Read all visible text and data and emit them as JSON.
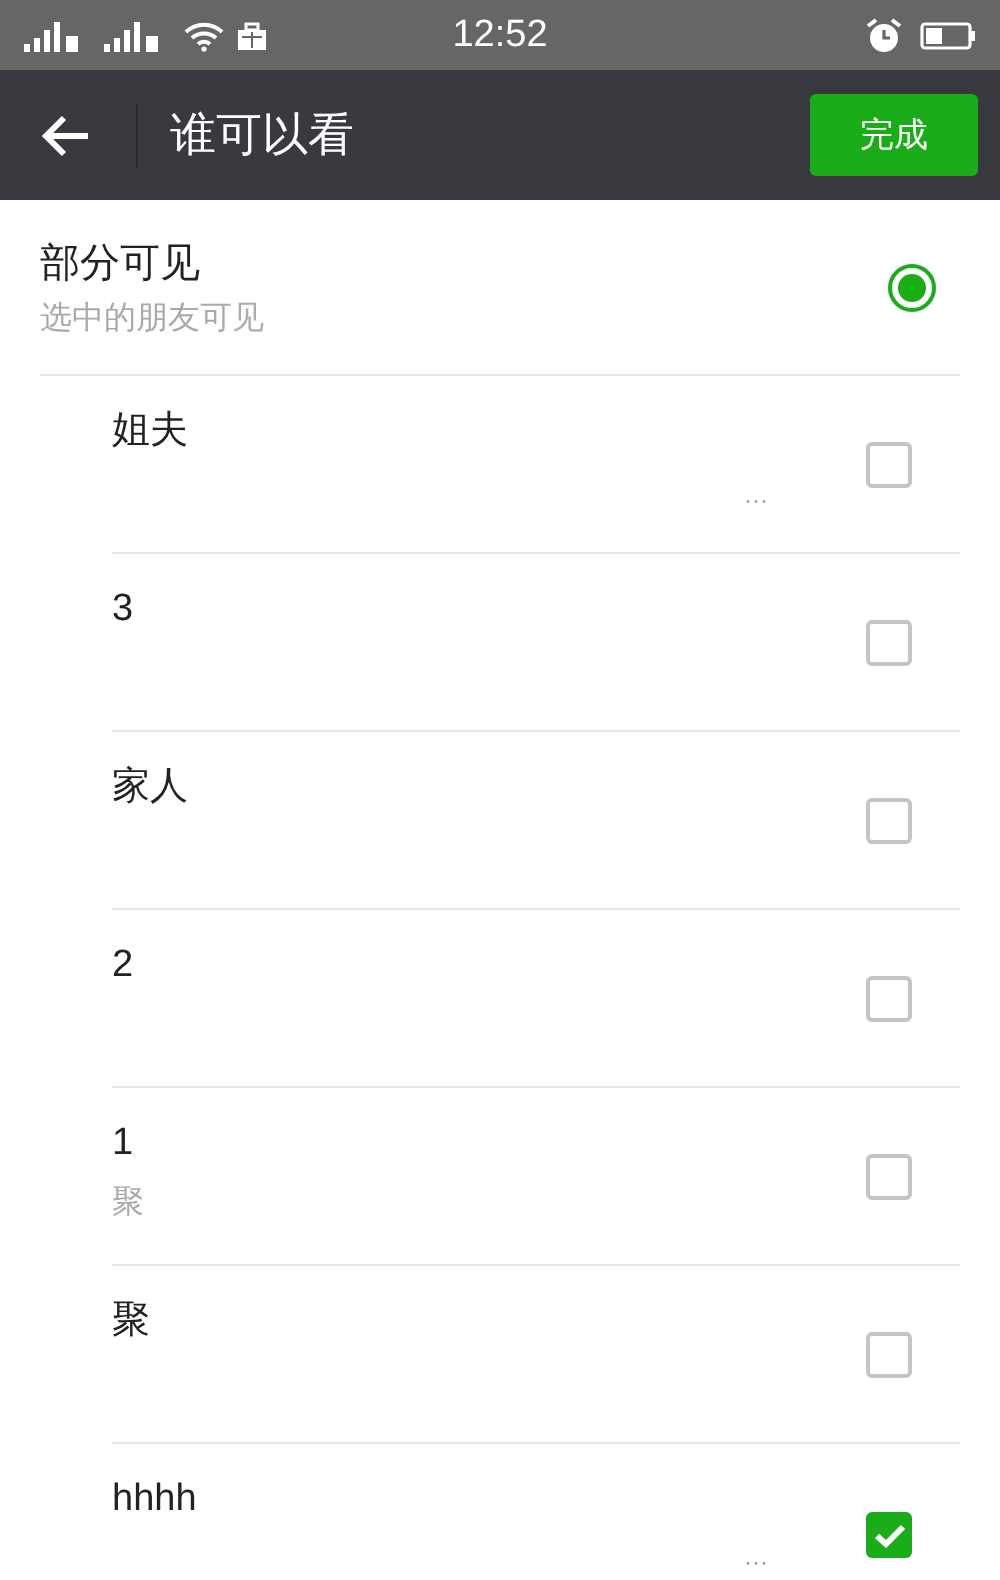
{
  "status_bar": {
    "time": "12:52"
  },
  "nav": {
    "title": "谁可以看",
    "done_button": "完成"
  },
  "option": {
    "title": "部分可见",
    "subtitle": "选中的朋友可见",
    "selected": true
  },
  "friends": [
    {
      "name": "姐夫",
      "more": "···",
      "checked": false
    },
    {
      "name": "3",
      "checked": false
    },
    {
      "name": "家人",
      "checked": false
    },
    {
      "name": "2",
      "checked": false
    },
    {
      "name": "1",
      "members": "聚",
      "checked": false
    },
    {
      "name": "聚",
      "checked": false
    },
    {
      "name": "hhhh",
      "more": "···",
      "checked": true
    }
  ]
}
